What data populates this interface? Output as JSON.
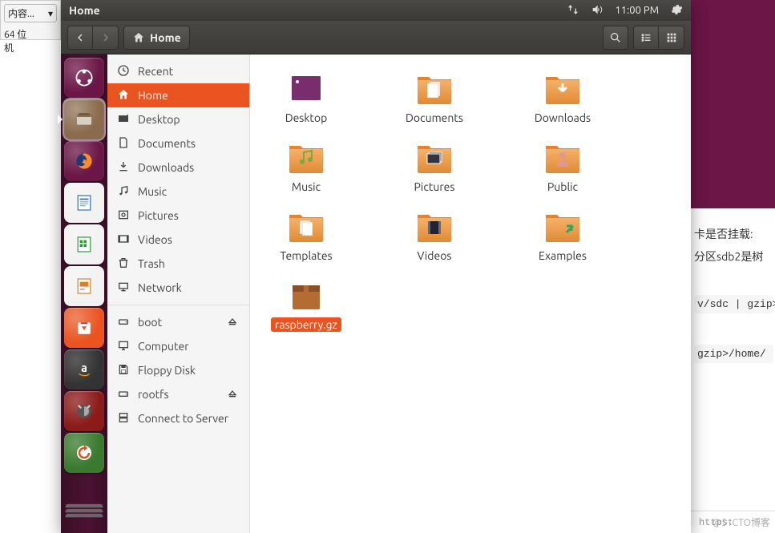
{
  "host": {
    "dropdown_label": "内容...",
    "label_64bit": "64 位",
    "label_machine": "机",
    "right_band_color": "#6b1646",
    "line1": "卡是否挂载:",
    "line2": "分区sdb2是树",
    "code1": "v/sdc | gzip>",
    "code2": "gzip>/home/",
    "footer_source": "https://blog.csdn.net/liup",
    "footer_brand": "@51CTO博客"
  },
  "topbar": {
    "title": "Home",
    "net_icon": "network-updown-icon",
    "sound_icon": "volume-icon",
    "time": "11:00 PM",
    "gear_icon": "gear-icon"
  },
  "toolbar": {
    "back_icon": "chevron-left-icon",
    "fwd_icon": "chevron-right-icon",
    "path_icon": "home-icon",
    "path_label": "Home",
    "search_icon": "search-icon",
    "view_list_icon": "view-list-icon",
    "view_grid_icon": "view-grid-icon"
  },
  "launcher": {
    "items": [
      {
        "name": "dash-icon",
        "cls": "dash"
      },
      {
        "name": "files-icon",
        "cls": "brown",
        "active": true
      },
      {
        "name": "firefox-icon",
        "cls": "dash"
      },
      {
        "name": "writer-icon",
        "cls": "white"
      },
      {
        "name": "calc-icon",
        "cls": "white"
      },
      {
        "name": "impress-icon",
        "cls": "white"
      },
      {
        "name": "software-icon",
        "cls": "orange"
      },
      {
        "name": "amazon-icon",
        "cls": "dark"
      },
      {
        "name": "settings-icon",
        "cls": "red"
      },
      {
        "name": "updater-icon",
        "cls": "green"
      }
    ]
  },
  "sidebar": {
    "items": [
      {
        "icon": "recent-icon",
        "label": "Recent"
      },
      {
        "icon": "home-icon",
        "label": "Home",
        "selected": true
      },
      {
        "icon": "desktop-icon",
        "label": "Desktop"
      },
      {
        "icon": "documents-icon",
        "label": "Documents"
      },
      {
        "icon": "downloads-icon",
        "label": "Downloads"
      },
      {
        "icon": "music-icon",
        "label": "Music"
      },
      {
        "icon": "pictures-icon",
        "label": "Pictures"
      },
      {
        "icon": "videos-icon",
        "label": "Videos"
      },
      {
        "icon": "trash-icon",
        "label": "Trash"
      },
      {
        "icon": "network-icon",
        "label": "Network"
      }
    ],
    "devices": [
      {
        "icon": "drive-icon",
        "label": "boot",
        "eject": true
      },
      {
        "icon": "computer-icon",
        "label": "Computer"
      },
      {
        "icon": "floppy-icon",
        "label": "Floppy Disk"
      },
      {
        "icon": "drive-icon",
        "label": "rootfs",
        "eject": true
      },
      {
        "icon": "server-icon",
        "label": "Connect to Server"
      }
    ]
  },
  "content": {
    "items": [
      {
        "type": "desktop",
        "label": "Desktop"
      },
      {
        "type": "folder",
        "label": "Documents",
        "deco": "doc"
      },
      {
        "type": "folder",
        "label": "Downloads",
        "deco": "down"
      },
      {
        "type": "folder",
        "label": "Music",
        "deco": "music"
      },
      {
        "type": "folder",
        "label": "Pictures",
        "deco": "pic"
      },
      {
        "type": "folder",
        "label": "Public",
        "deco": "pub"
      },
      {
        "type": "folder",
        "label": "Templates",
        "deco": "tmpl"
      },
      {
        "type": "folder",
        "label": "Videos",
        "deco": "vid"
      },
      {
        "type": "folder",
        "label": "Examples",
        "deco": "link"
      },
      {
        "type": "archive",
        "label": "raspberry.gz",
        "selected": true
      }
    ]
  }
}
